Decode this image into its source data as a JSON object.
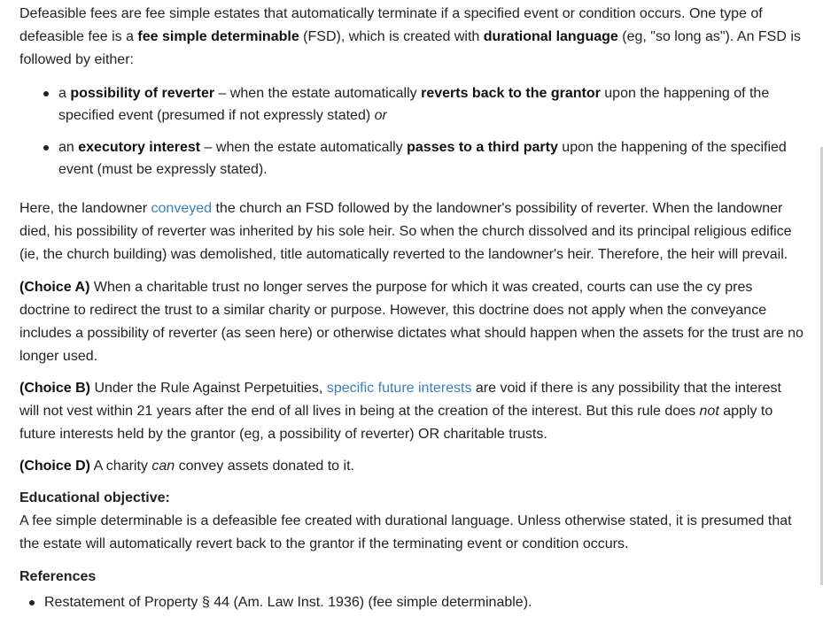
{
  "intro": {
    "t1": "Defeasible fees are fee simple estates that automatically terminate if a specified event or condition occurs.  One type of defeasible fee is a ",
    "b1": "fee simple determinable",
    "t2": " (FSD), which is created with ",
    "b2": "durational language",
    "t3": " (eg, \"so long as\").  An FSD is followed by either:"
  },
  "options": [
    {
      "t1": "a ",
      "b1": "possibility of reverter",
      "t2": " – when the estate automatically ",
      "b2": "reverts back to the grantor",
      "t3": " upon the happening of the specified event (presumed if not expressly stated) ",
      "i1": "or"
    },
    {
      "t1": "an ",
      "b1": "executory interest",
      "t2": " – when the estate automatically ",
      "b2": "passes to a third party",
      "t3": " upon the happening of the specified event (must be expressly stated)."
    }
  ],
  "explanation": {
    "t1": "Here, the landowner ",
    "link": "conveyed",
    "t2": " the church an FSD followed by the landowner's possibility of reverter.  When the landowner died, his possibility of reverter was inherited by his sole heir.  So when the church dissolved and its principal religious edifice (ie, the church building) was demolished, title automatically reverted to the landowner's heir.  Therefore, the heir will prevail."
  },
  "choice_a": {
    "label": "(Choice A)",
    "text": "  When a charitable trust no longer serves the purpose for which it was created, courts can use the cy pres doctrine to redirect the trust to a similar charity or purpose.  However, this doctrine does not apply when the conveyance includes a possibility of reverter (as seen here) or otherwise dictates what should happen when the assets for the trust are no longer used."
  },
  "choice_b": {
    "label": "(Choice B)",
    "t1": "  Under the Rule Against Perpetuities, ",
    "link": "specific future interests",
    "t2": " are void if there is any possibility that the interest will not vest within 21 years after the end of all lives in being at the creation of the interest.  But this rule does ",
    "i1": "not",
    "t3": " apply to future interests held by the grantor (eg, a possibility of reverter) OR charitable trusts."
  },
  "choice_d": {
    "label": "(Choice D)",
    "t1": "  A charity ",
    "i1": "can",
    "t2": " convey assets donated to it."
  },
  "educational": {
    "title": "Educational objective:",
    "text": "A fee simple determinable is a defeasible fee created with durational language.  Unless otherwise stated, it is presumed that the estate will automatically revert back to the grantor if the terminating event or condition occurs."
  },
  "references": {
    "title": "References",
    "items": [
      "Restatement of Property § 44 (Am. Law Inst. 1936) (fee simple determinable)."
    ]
  },
  "colors": {
    "link": "#3a7fc1",
    "text": "#222222"
  }
}
